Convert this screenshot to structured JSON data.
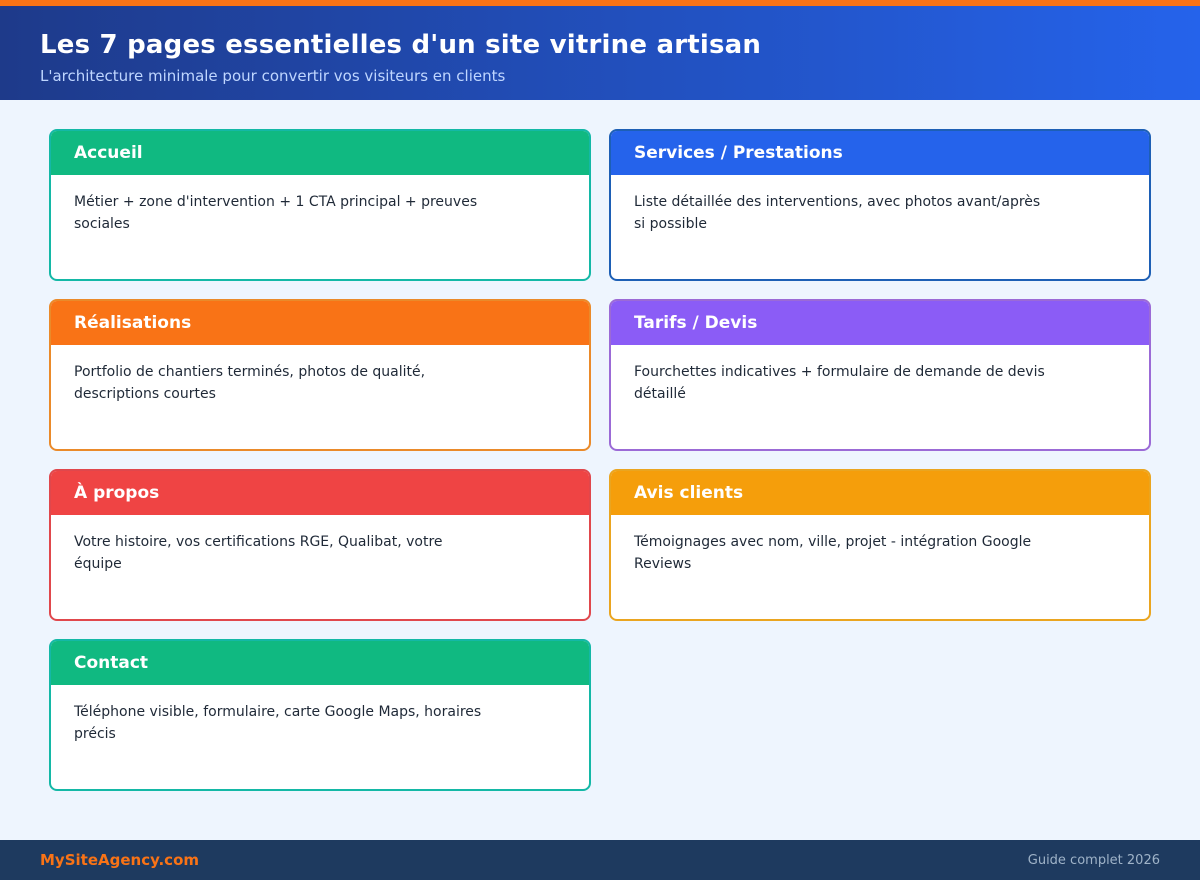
{
  "header": {
    "title": "Les 7 pages essentielles d'un site vitrine artisan",
    "subtitle": "L'architecture minimale pour convertir vos visiteurs en clients"
  },
  "cards": [
    {
      "title": "Accueil",
      "description": "Métier + zone d'intervention + 1 CTA principal + preuves sociales",
      "color": "#10b981",
      "border": "#14b8a6"
    },
    {
      "title": "Services / Prestations",
      "description": "Liste détaillée des interventions, avec photos avant/après si possible",
      "color": "#2563eb",
      "border": "#1d5fb5"
    },
    {
      "title": "Réalisations",
      "description": "Portfolio de chantiers terminés, photos de qualité, descriptions courtes",
      "color": "#f97316",
      "border": "#ea8a2a"
    },
    {
      "title": "Tarifs / Devis",
      "description": "Fourchettes indicatives + formulaire de demande de devis détaillé",
      "color": "#8b5cf6",
      "border": "#9b6ad6"
    },
    {
      "title": "À propos",
      "description": "Votre histoire, vos certifications RGE, Qualibat, votre équipe",
      "color": "#ef4444",
      "border": "#e0474c"
    },
    {
      "title": "Avis clients",
      "description": "Témoignages avec nom, ville, projet - intégration Google Reviews",
      "color": "#f59e0b",
      "border": "#eaa520"
    },
    {
      "title": "Contact",
      "description": "Téléphone visible, formulaire, carte Google Maps, horaires précis",
      "color": "#10b981",
      "border": "#14b8a6"
    }
  ],
  "footer": {
    "brand": "MySiteAgency.com",
    "note": "Guide complet 2026"
  }
}
